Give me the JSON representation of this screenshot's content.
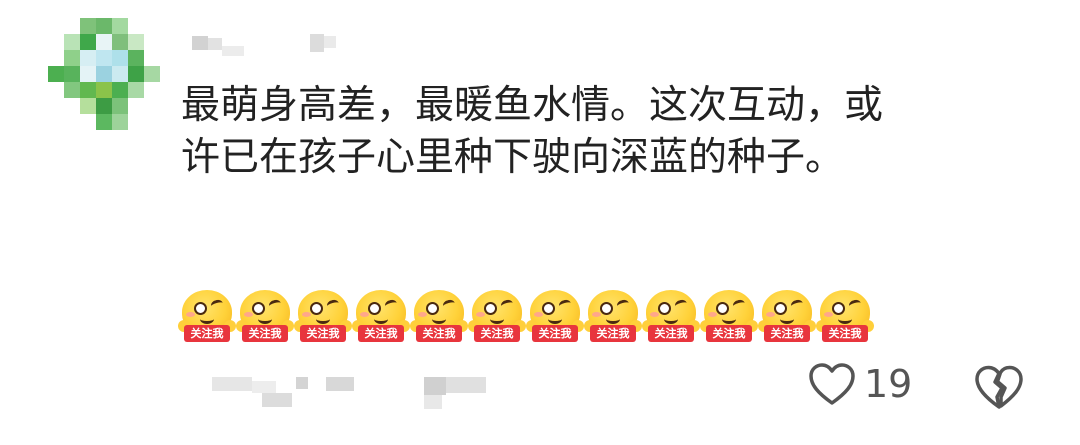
{
  "comment": {
    "lines": [
      "最萌身高差，最暖鱼水情。这次互动，或",
      "许已在孩子心里种下驶向深蓝的种子。"
    ],
    "emoji_sticker_label": "关注我",
    "emoji_count": 12,
    "like_count": "19"
  },
  "icons": {
    "like": "heart-outline-icon",
    "dislike": "broken-heart-icon"
  },
  "colors": {
    "text": "#222222",
    "muted": "#555555",
    "sticker_red": "#e8353d",
    "emoji_yellow": "#ffd23a"
  }
}
